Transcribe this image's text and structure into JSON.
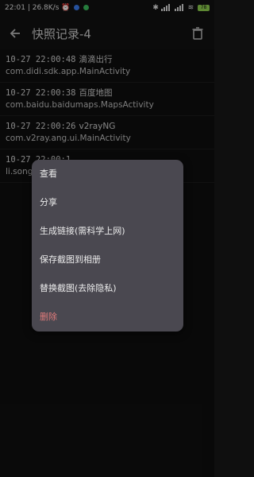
{
  "status_bar": {
    "time": "22:01",
    "speed": "26.8K/s",
    "battery": "78"
  },
  "app_bar": {
    "back_icon": "arrow-left-icon",
    "title": "快照记录-4",
    "delete_icon": "trash-icon"
  },
  "records": [
    {
      "time": "10-27 22:00:48",
      "app": "滴滴出行",
      "activity": "com.didi.sdk.app.MainActivity"
    },
    {
      "time": "10-27 22:00:38",
      "app": "百度地图",
      "activity": "com.baidu.baidumaps.MapsActivity"
    },
    {
      "time": "10-27 22:00:26",
      "app": "v2rayNG",
      "activity": "com.v2ray.ang.ui.MainActivity"
    },
    {
      "time": "10-27 22:00:1",
      "app": "",
      "activity": "li.song"
    }
  ],
  "context_menu": {
    "items": [
      {
        "label": "查看"
      },
      {
        "label": "分享"
      },
      {
        "label": "生成链接(需科学上网)"
      },
      {
        "label": "保存截图到相册"
      },
      {
        "label": "替换截图(去除隐私)"
      },
      {
        "label": "删除"
      }
    ]
  },
  "colors": {
    "background": "#0f0f0f",
    "menu_bg": "#4a4850",
    "danger": "#e37c7c"
  }
}
